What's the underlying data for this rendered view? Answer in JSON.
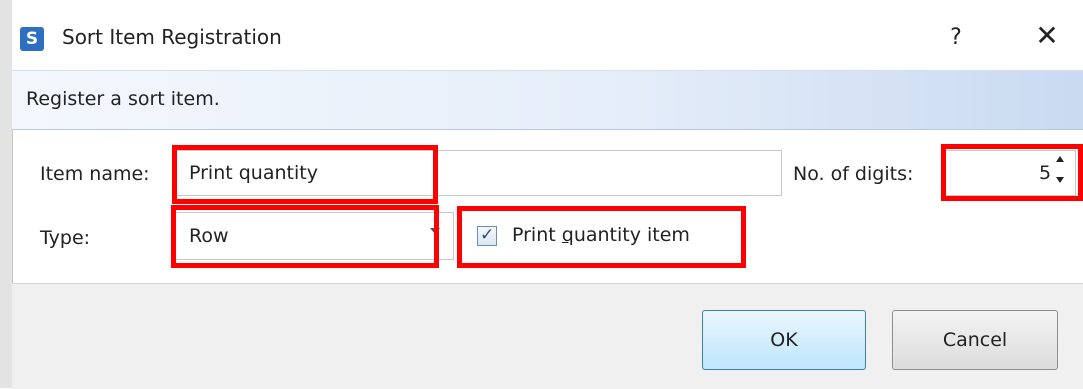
{
  "window": {
    "title": "Sort Item Registration",
    "app_icon_letter": "S",
    "help_symbol": "?",
    "close_symbol": "✕"
  },
  "banner": {
    "text": "Register a sort item."
  },
  "form": {
    "item_name_label": "Item name:",
    "item_name_value": "Print quantity",
    "digits_label": "No. of digits:",
    "digits_value": "5",
    "type_label": "Type:",
    "type_value": "Row",
    "print_quantity_checkbox": {
      "label_before": "Print ",
      "label_mnemonic": "q",
      "label_after": "uantity item",
      "checked": true
    }
  },
  "buttons": {
    "ok": "OK",
    "cancel": "Cancel"
  },
  "highlights": {
    "color": "#ff0000"
  },
  "icons": [
    "app-s-icon",
    "help-icon",
    "close-icon",
    "chevron-down-icon",
    "spin-up-icon",
    "spin-down-icon",
    "check-icon"
  ]
}
